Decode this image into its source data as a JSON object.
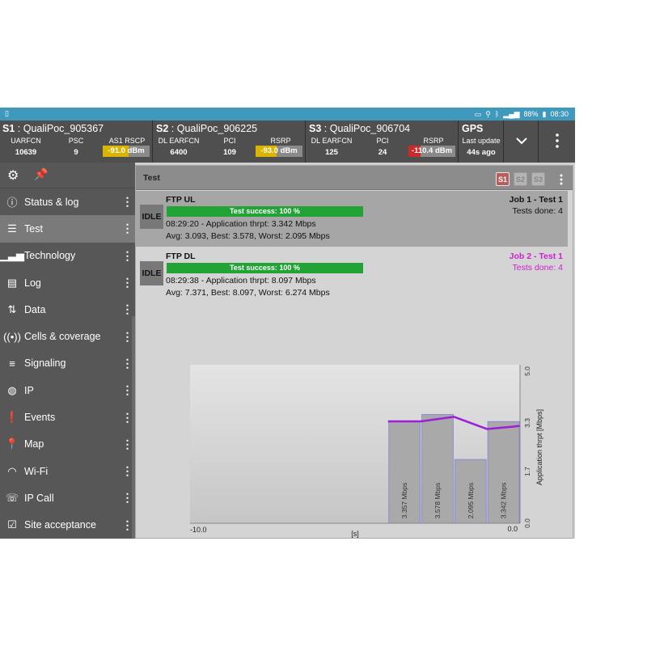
{
  "statusbar": {
    "left_glyph": "▯",
    "battery": "88%",
    "time": "08:30"
  },
  "header": {
    "s1": {
      "label": "S1",
      "name": " : QualiPoc_905367",
      "c1_label": "UARFCN",
      "c1_value": "10639",
      "c2_label": "PSC",
      "c2_value": "9",
      "c3_label": "AS1 RSCP",
      "c3_value": "-91.0 dBm",
      "c3_color": "#d9b400",
      "c3_fraction": 0.55
    },
    "s2": {
      "label": "S2",
      "name": " : QualiPoc_906225",
      "c1_label": "DL EARFCN",
      "c1_value": "6400",
      "c2_label": "PCI",
      "c2_value": "109",
      "c3_label": "RSRP",
      "c3_value": "-93.0 dBm",
      "c3_color": "#d9b400",
      "c3_fraction": 0.45
    },
    "s3": {
      "label": "S3",
      "name": " : QualiPoc_906704",
      "c1_label": "DL EARFCN",
      "c1_value": "125",
      "c2_label": "PCI",
      "c2_value": "24",
      "c3_label": "RSRP",
      "c3_value": "-110.4 dBm",
      "c3_color": "#cc2a2a",
      "c3_fraction": 0.25
    },
    "gps": {
      "title": "GPS",
      "label": "Last update",
      "value": "44s ago"
    }
  },
  "sidebar": {
    "items": [
      {
        "label": "Status & log",
        "icon": "info-icon"
      },
      {
        "label": "Test",
        "icon": "list-icon",
        "active": true
      },
      {
        "label": "Technology",
        "icon": "signal-bars-icon"
      },
      {
        "label": "Log",
        "icon": "log-icon"
      },
      {
        "label": "Data",
        "icon": "updown-arrows-icon"
      },
      {
        "label": "Cells & coverage",
        "icon": "antenna-icon"
      },
      {
        "label": "Signaling",
        "icon": "signaling-icon"
      },
      {
        "label": "IP",
        "icon": "globe-icon"
      },
      {
        "label": "Events",
        "icon": "alert-icon"
      },
      {
        "label": "Map",
        "icon": "map-pin-icon"
      },
      {
        "label": "Wi-Fi",
        "icon": "wifi-icon"
      },
      {
        "label": "IP Call",
        "icon": "phone-icon"
      },
      {
        "label": "Site acceptance",
        "icon": "checkbox-icon"
      }
    ]
  },
  "main": {
    "title": "Test",
    "tabs": [
      "S1",
      "S2",
      "S3"
    ],
    "jobs": [
      {
        "name": "FTP UL",
        "state": "IDLE",
        "progress_text": "Test success: 100 %",
        "progress": 100,
        "line1": "08:29:20 - Application thrpt: 3.342 Mbps",
        "line2": "Avg: 3.093, Best: 3.578, Worst: 2.095 Mbps",
        "job_title": "Job 1 - Test 1",
        "tests_done": "Tests done: 4",
        "color": "#111111"
      },
      {
        "name": "FTP DL",
        "state": "IDLE",
        "progress_text": "Test success: 100 %",
        "progress": 100,
        "line1": "08:29:38 - Application thrpt: 8.097 Mbps",
        "line2": "Avg: 7.371, Best: 8.097, Worst: 6.274 Mbps",
        "job_title": "Job 2 - Test 1",
        "tests_done": "Tests done: 4",
        "color": "#cc22cc"
      }
    ]
  },
  "chart_data": {
    "type": "bar",
    "xlabel": "[s]",
    "ylabel": "Application thrpt [Mbps]",
    "xlim": [
      -10.0,
      0.0
    ],
    "ylim": [
      0.0,
      5.0
    ],
    "x_tick_labels": [
      "-10.0",
      "0.0"
    ],
    "y_tick_labels": [
      "0.0",
      "1.7",
      "3.3",
      "5.0"
    ],
    "bars": [
      {
        "x0": -4.0,
        "x1": -3.0,
        "value": 3.357,
        "label": "3.357 Mbps"
      },
      {
        "x0": -3.0,
        "x1": -2.0,
        "value": 3.578,
        "label": "3.578 Mbps"
      },
      {
        "x0": -2.0,
        "x1": -1.0,
        "value": 2.095,
        "label": "2.095 Mbps"
      },
      {
        "x0": -1.0,
        "x1": 0.0,
        "value": 3.342,
        "label": "3.342 Mbps"
      }
    ],
    "line": {
      "color": "#9c1fd6",
      "x": [
        -4.0,
        -3.0,
        -2.0,
        -1.0,
        0.0
      ],
      "y": [
        3.35,
        3.35,
        3.5,
        3.1,
        3.2
      ]
    }
  }
}
